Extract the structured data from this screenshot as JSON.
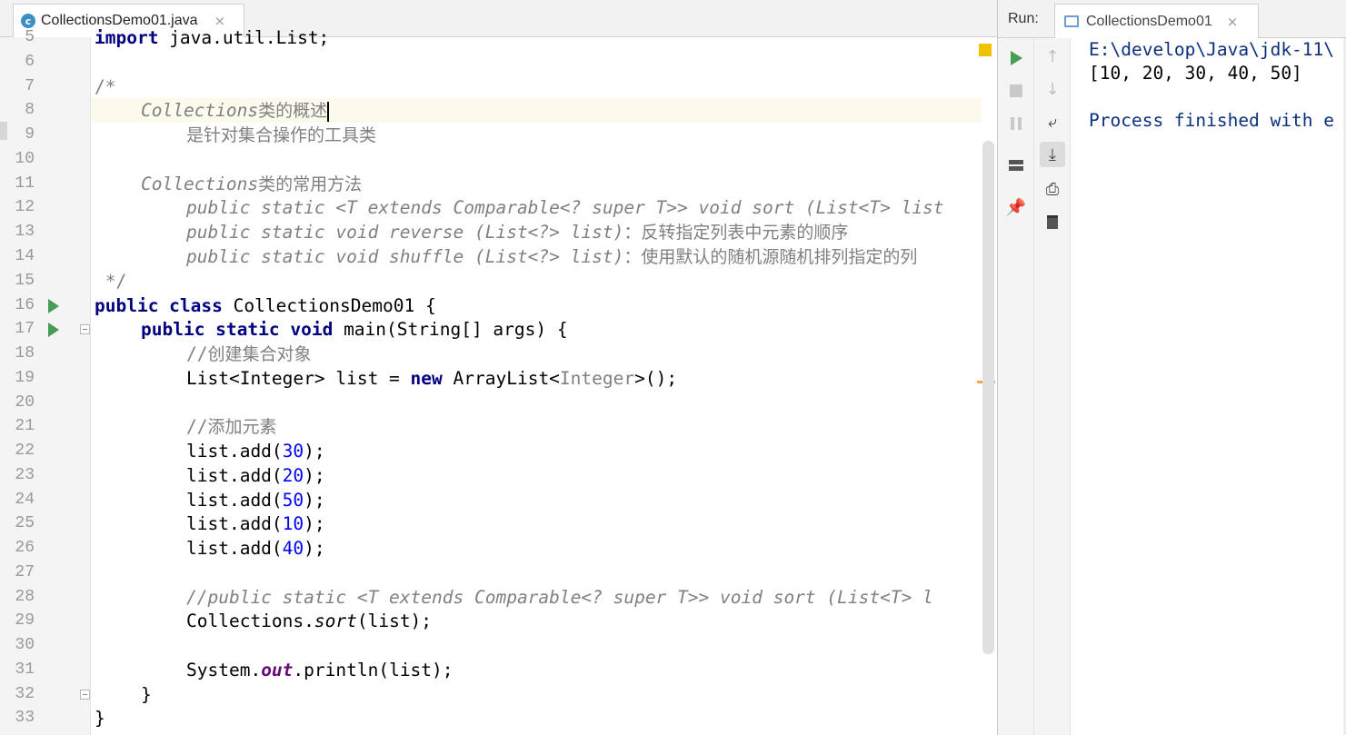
{
  "editor": {
    "tab": {
      "label": "CollectionsDemo01.java",
      "icon": "java-class-icon",
      "close": "×"
    },
    "code_lines": [
      {
        "n": "5",
        "text": "import java.util.List;"
      },
      {
        "n": "6",
        "text": ""
      },
      {
        "n": "7",
        "text": "/*"
      },
      {
        "n": "8",
        "text": "    Collections类的概述"
      },
      {
        "n": "9",
        "text": "        是针对集合操作的工具类"
      },
      {
        "n": "10",
        "text": ""
      },
      {
        "n": "11",
        "text": "    Collections类的常用方法"
      },
      {
        "n": "12",
        "text": "        public static <T extends Comparable<? super T>> void sort (List<T> list"
      },
      {
        "n": "13",
        "text": "        public static void reverse (List<?> list)：反转指定列表中元素的顺序"
      },
      {
        "n": "14",
        "text": "        public static void shuffle (List<?> list)：使用默认的随机源随机排列指定的列"
      },
      {
        "n": "15",
        "text": " */"
      },
      {
        "n": "16",
        "text": "public class CollectionsDemo01 {"
      },
      {
        "n": "17",
        "text": "    public static void main(String[] args) {"
      },
      {
        "n": "18",
        "text": "        //创建集合对象"
      },
      {
        "n": "19",
        "text": "        List<Integer> list = new ArrayList<Integer>();"
      },
      {
        "n": "20",
        "text": ""
      },
      {
        "n": "21",
        "text": "        //添加元素"
      },
      {
        "n": "22",
        "text": "        list.add(30);"
      },
      {
        "n": "23",
        "text": "        list.add(20);"
      },
      {
        "n": "24",
        "text": "        list.add(50);"
      },
      {
        "n": "25",
        "text": "        list.add(10);"
      },
      {
        "n": "26",
        "text": "        list.add(40);"
      },
      {
        "n": "27",
        "text": ""
      },
      {
        "n": "28",
        "text": "        //public static <T extends Comparable<? super T>> void sort (List<T> l"
      },
      {
        "n": "29",
        "text": "        Collections.sort(list);"
      },
      {
        "n": "30",
        "text": ""
      },
      {
        "n": "31",
        "text": "        System.out.println(list);"
      },
      {
        "n": "32",
        "text": "    }"
      },
      {
        "n": "33",
        "text": "}"
      }
    ],
    "tokens": {
      "import_kw": "import",
      "import_rest": " java.util.List;",
      "c7": "/*",
      "c8_a": "Collections",
      "c8_b": "类的概述",
      "c9": "是针对集合操作的工具类",
      "c11_a": "Collections",
      "c11_b": "类的常用方法",
      "c12": "public static <T extends Comparable<? super T>> void sort (List<T> list",
      "c13_a": "public static void reverse (List<?> list)",
      "c13_b": "：反转指定列表中元素的顺序",
      "c14_a": "public static void shuffle (List<?> list)",
      "c14_b": "：使用默认的随机源随机排列指定的列",
      "c15": " */",
      "l16_kw": "public class",
      "l16_rest": " CollectionsDemo01 {",
      "l17_kw": "public static void",
      "l17_rest": " main(String[] args) {",
      "l18_a": "//",
      "l18_b": "创建集合对象",
      "l19_a": "List<Integer> list = ",
      "l19_kw": "new",
      "l19_b": " ArrayList<",
      "l19_gen": "Integer",
      "l19_c": ">();",
      "l21_a": "//",
      "l21_b": "添加元素",
      "add_prefix": "list.add(",
      "add_suffix": ");",
      "add_values": [
        "30",
        "20",
        "50",
        "10",
        "40"
      ],
      "l28": "//public static <T extends Comparable<? super T>> void sort (List<T> l",
      "l29_a": "Collections.",
      "l29_b": "sort",
      "l29_c": "(list);",
      "l31_a": "System.",
      "l31_b": "out",
      "l31_c": ".println(list);",
      "l32": "}",
      "l33": "}"
    }
  },
  "run": {
    "title": "Run:",
    "tab": {
      "label": "CollectionsDemo01",
      "close": "×"
    },
    "toolbar_left": [
      {
        "name": "rerun-icon"
      },
      {
        "name": "stop-icon"
      },
      {
        "name": "pause-icon"
      },
      {
        "name": "layout-icon"
      },
      {
        "name": "pin-icon"
      }
    ],
    "toolbar_right": [
      {
        "name": "up-arrow-icon",
        "glyph": "↑"
      },
      {
        "name": "down-arrow-icon",
        "glyph": "↓"
      },
      {
        "name": "soft-wrap-icon",
        "glyph": "⤶"
      },
      {
        "name": "scroll-to-end-icon",
        "glyph": "⤓"
      },
      {
        "name": "print-icon",
        "glyph": "⎙"
      },
      {
        "name": "trash-icon"
      }
    ],
    "console": {
      "path": "E:\\develop\\Java\\jdk-11\\",
      "output": "[10, 20, 30, 40, 50]",
      "finished": "Process finished with e"
    }
  },
  "colors": {
    "keyword": "#000080",
    "number": "#0000ff",
    "comment": "#808080",
    "field": "#660e7a",
    "run_green": "#499c54",
    "console_blue": "#0b2f7e"
  }
}
